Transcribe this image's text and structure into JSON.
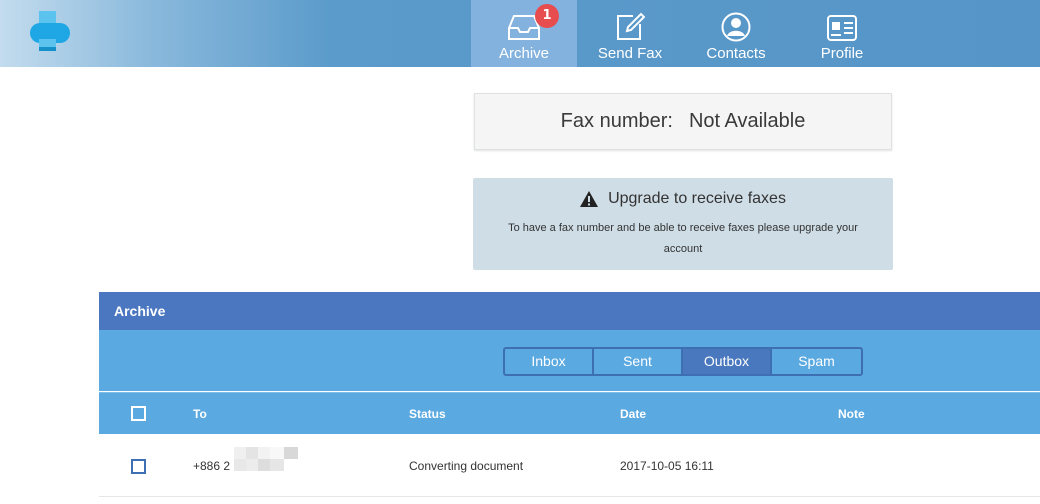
{
  "nav": {
    "items": [
      {
        "label": "Archive",
        "icon": "inbox-tray-icon",
        "active": true,
        "badge": "1"
      },
      {
        "label": "Send Fax",
        "icon": "edit-icon",
        "active": false
      },
      {
        "label": "Contacts",
        "icon": "user-icon",
        "active": false
      },
      {
        "label": "Profile",
        "icon": "id-card-icon",
        "active": false
      }
    ]
  },
  "fax": {
    "label": "Fax number:",
    "value": "Not Available"
  },
  "upgrade": {
    "title": "Upgrade to receive faxes",
    "text": "To have a fax number and be able to receive faxes please upgrade your account"
  },
  "archive": {
    "title": "Archive",
    "filters": [
      "Inbox",
      "Sent",
      "Outbox",
      "Spam"
    ],
    "active_filter": "Outbox",
    "columns": {
      "to": "To",
      "status": "Status",
      "date": "Date",
      "note": "Note"
    },
    "rows": [
      {
        "to": "+886 2",
        "status": "Converting document",
        "date": "2017-10-05 16:11",
        "note": ""
      }
    ]
  },
  "colors": {
    "header_bar": "#4a77bf",
    "filter_bar": "#5aa9e0",
    "nav_active": "#82b2dd",
    "badge": "#e74c4f"
  }
}
